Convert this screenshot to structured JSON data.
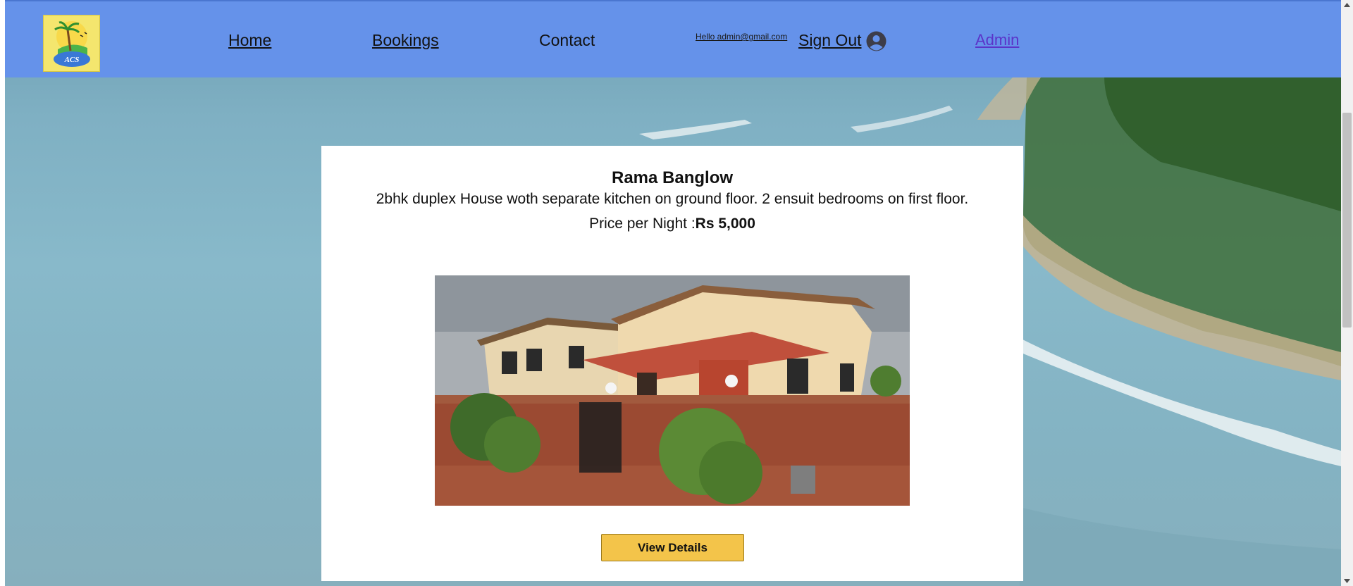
{
  "nav": {
    "logo_text": "ACS",
    "home_label": "Home",
    "bookings_label": "Bookings",
    "contact_label": "Contact",
    "greeting": "Hello admin@gmail.com",
    "signout_label": "Sign Out",
    "admin_label": "Admin"
  },
  "property": {
    "title": "Rama Banglow",
    "description": "2bhk duplex House woth separate kitchen on ground floor. 2 ensuit bedrooms on first floor.",
    "price_prefix": "Price per Night :",
    "price_value": "Rs 5,000",
    "view_details_label": "View Details"
  },
  "icons": {
    "logo": "palm-tree-logo-icon",
    "user": "user-circle-icon",
    "scroll_up": "scroll-up-arrow-icon",
    "scroll_down": "scroll-down-arrow-icon"
  },
  "colors": {
    "navbar": "#6592ea",
    "admin_link": "#5b34c9",
    "button": "#f3c44a"
  }
}
